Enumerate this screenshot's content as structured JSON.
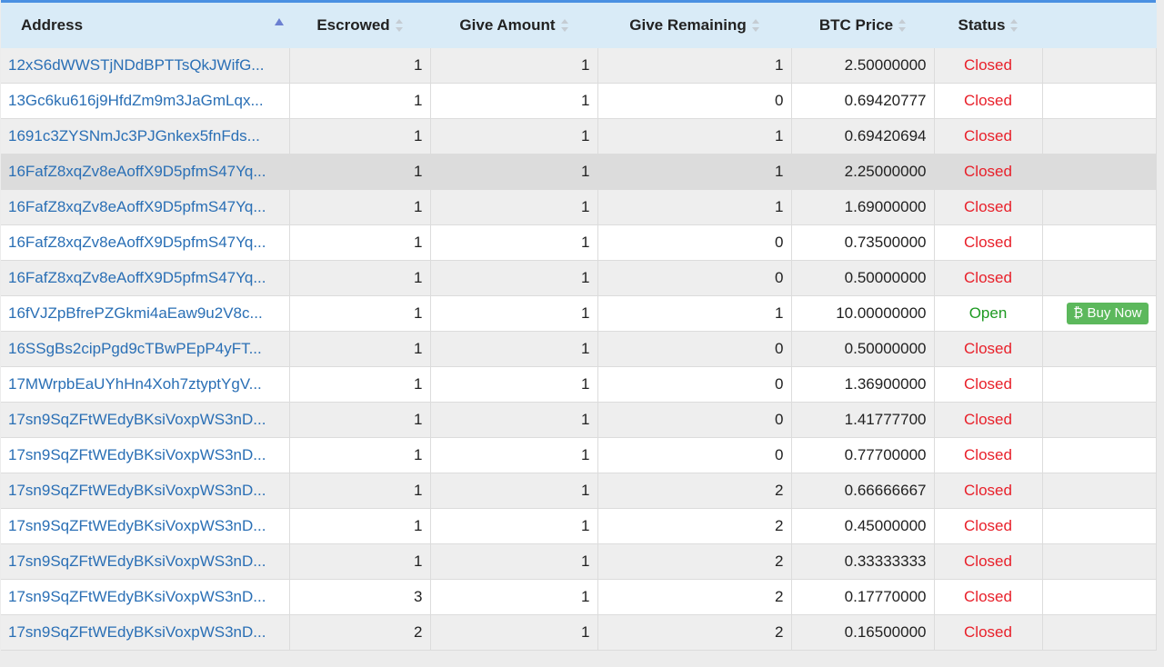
{
  "columns": {
    "address": "Address",
    "escrowed": "Escrowed",
    "give_amount": "Give Amount",
    "give_remaining": "Give Remaining",
    "btc_price": "BTC Price",
    "status": "Status"
  },
  "buy_label": "₿ Buy Now",
  "colors": {
    "header_bg": "#d9ebf7",
    "accent": "#4a90e2",
    "closed": "#e8202a",
    "open": "#1e9a22",
    "buy_button": "#5cb85c",
    "link": "#2a6fb5"
  },
  "rows": [
    {
      "address": "12xS6dWWSTjNDdBPTTsQkJWifG...",
      "escrowed": "1",
      "give": "1",
      "remaining": "1",
      "price": "2.50000000",
      "status": "Closed",
      "action": ""
    },
    {
      "address": "13Gc6ku616j9HfdZm9m3JaGmLqx...",
      "escrowed": "1",
      "give": "1",
      "remaining": "0",
      "price": "0.69420777",
      "status": "Closed",
      "action": ""
    },
    {
      "address": "1691c3ZYSNmJc3PJGnkex5fnFds...",
      "escrowed": "1",
      "give": "1",
      "remaining": "1",
      "price": "0.69420694",
      "status": "Closed",
      "action": ""
    },
    {
      "address": "16FafZ8xqZv8eAoffX9D5pfmS47Yq...",
      "escrowed": "1",
      "give": "1",
      "remaining": "1",
      "price": "2.25000000",
      "status": "Closed",
      "action": ""
    },
    {
      "address": "16FafZ8xqZv8eAoffX9D5pfmS47Yq...",
      "escrowed": "1",
      "give": "1",
      "remaining": "1",
      "price": "1.69000000",
      "status": "Closed",
      "action": ""
    },
    {
      "address": "16FafZ8xqZv8eAoffX9D5pfmS47Yq...",
      "escrowed": "1",
      "give": "1",
      "remaining": "0",
      "price": "0.73500000",
      "status": "Closed",
      "action": ""
    },
    {
      "address": "16FafZ8xqZv8eAoffX9D5pfmS47Yq...",
      "escrowed": "1",
      "give": "1",
      "remaining": "0",
      "price": "0.50000000",
      "status": "Closed",
      "action": ""
    },
    {
      "address": "16fVJZpBfrePZGkmi4aEaw9u2V8c...",
      "escrowed": "1",
      "give": "1",
      "remaining": "1",
      "price": "10.00000000",
      "status": "Open",
      "action": "buy"
    },
    {
      "address": "16SSgBs2cipPgd9cTBwPEpP4yFT...",
      "escrowed": "1",
      "give": "1",
      "remaining": "0",
      "price": "0.50000000",
      "status": "Closed",
      "action": ""
    },
    {
      "address": "17MWrpbEaUYhHn4Xoh7ztyptYgV...",
      "escrowed": "1",
      "give": "1",
      "remaining": "0",
      "price": "1.36900000",
      "status": "Closed",
      "action": ""
    },
    {
      "address": "17sn9SqZFtWEdyBKsiVoxpWS3nD...",
      "escrowed": "1",
      "give": "1",
      "remaining": "0",
      "price": "1.41777700",
      "status": "Closed",
      "action": ""
    },
    {
      "address": "17sn9SqZFtWEdyBKsiVoxpWS3nD...",
      "escrowed": "1",
      "give": "1",
      "remaining": "0",
      "price": "0.77700000",
      "status": "Closed",
      "action": ""
    },
    {
      "address": "17sn9SqZFtWEdyBKsiVoxpWS3nD...",
      "escrowed": "1",
      "give": "1",
      "remaining": "2",
      "price": "0.66666667",
      "status": "Closed",
      "action": ""
    },
    {
      "address": "17sn9SqZFtWEdyBKsiVoxpWS3nD...",
      "escrowed": "1",
      "give": "1",
      "remaining": "2",
      "price": "0.45000000",
      "status": "Closed",
      "action": ""
    },
    {
      "address": "17sn9SqZFtWEdyBKsiVoxpWS3nD...",
      "escrowed": "1",
      "give": "1",
      "remaining": "2",
      "price": "0.33333333",
      "status": "Closed",
      "action": ""
    },
    {
      "address": "17sn9SqZFtWEdyBKsiVoxpWS3nD...",
      "escrowed": "3",
      "give": "1",
      "remaining": "2",
      "price": "0.17770000",
      "status": "Closed",
      "action": ""
    },
    {
      "address": "17sn9SqZFtWEdyBKsiVoxpWS3nD...",
      "escrowed": "2",
      "give": "1",
      "remaining": "2",
      "price": "0.16500000",
      "status": "Closed",
      "action": ""
    }
  ]
}
